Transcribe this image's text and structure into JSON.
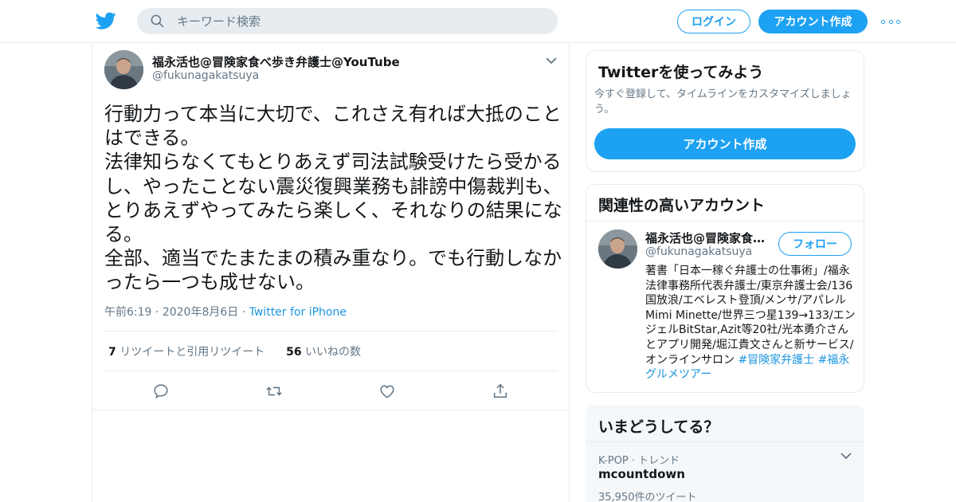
{
  "topbar": {
    "search_placeholder": "キーワード検索",
    "login_label": "ログイン",
    "signup_label": "アカウント作成",
    "logo_icon": "twitter-bird-icon",
    "more_icon": "more-dots-icon",
    "brand_color": "#1da1f2"
  },
  "tweet": {
    "author_name": "福永活也@冒険家食べ歩き弁護士@YouTube",
    "author_handle": "@fukunagakatsuya",
    "text": "行動力って本当に大切で、これさえ有れば大抵のことはできる。\n法律知らなくてもとりあえず司法試験受けたら受かるし、やったことない震災復興業務も誹謗中傷裁判も、とりあえずやってみたら楽しく、それなりの結果になる。\n全部、適当でたまたまの積み重なり。でも行動しなかったら一つも成せない。",
    "time": "午前6:19",
    "date": "2020年8月6日",
    "via": "Twitter for iPhone",
    "retweet_count": "7",
    "retweet_label": "リツイートと引用リツイート",
    "like_count": "56",
    "like_label": "いいねの数",
    "action_icons": [
      "reply-icon",
      "retweet-icon",
      "like-icon",
      "share-icon"
    ]
  },
  "signup_card": {
    "title": "Twitterを使ってみよう",
    "description": "今すぐ登録して、タイムラインをカスタマイズしましょう。",
    "button_label": "アカウント作成"
  },
  "related_card": {
    "title": "関連性の高いアカウント",
    "name": "福永活也@冒険家食べ歩き弁護士@YouTube",
    "handle": "@fukunagakatsuya",
    "follow_label": "フォロー",
    "bio": "著書「日本一稼ぐ弁護士の仕事術」/福永法律事務所代表弁護士/東京弁護士会/136国放浪/エベレスト登頂/メンサ/アパレルMimi Minette/世界三つ星139→133/エンジェルBitStar,Azit等20社/光本勇介さんとアプリ開発/堀江貴文さんと新サービス/オンラインサロン",
    "tag1": "#冒険家弁護士",
    "tag2": "#福永グルメツアー"
  },
  "trend_card": {
    "title": "いまどうしてる？",
    "category": "K-POP · トレンド",
    "name": "mcountdown",
    "count": "35,950件のツイート"
  }
}
